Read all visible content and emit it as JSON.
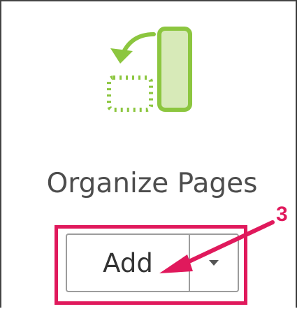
{
  "tool": {
    "name": "Organize Pages",
    "icon": "organize-pages-icon",
    "add_label": "Add",
    "dropdown_icon": "caret-down-icon"
  },
  "annotation": {
    "step_number": "3",
    "color": "#e0195c"
  },
  "colors": {
    "icon_green": "#8cc63f",
    "icon_fill": "#d7eab8",
    "label_text": "#4d4d4d",
    "button_border": "#9c9c9c"
  }
}
